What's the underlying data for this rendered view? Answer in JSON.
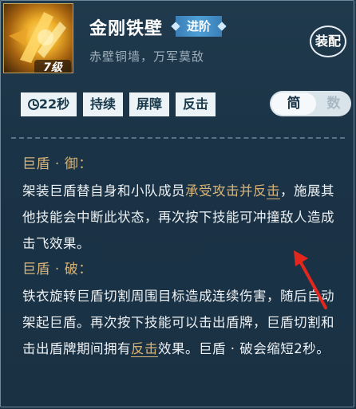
{
  "skill": {
    "name": "金刚铁壁",
    "advance_label": "进阶",
    "subtitle": "赤壁铜墙，万军莫敌",
    "level": "7级",
    "equip_label": "装配"
  },
  "tags": {
    "cooldown": "22秒",
    "items": [
      "持续",
      "屏障",
      "反击"
    ]
  },
  "toggle": {
    "simple": "简",
    "number": "数"
  },
  "description": {
    "section1_title": "巨盾 · 御：",
    "s1_p1": "架装巨盾替自身和小队成员",
    "s1_hl": "承受攻击并反",
    "s1_hl2": "击",
    "s1_p2": "，施展其他技能会中断此状态，再次按下技能可冲撞敌人造成击飞效果。",
    "section2_title": "巨盾 · 破：",
    "s2_p1": "铁衣旋转巨盾切割周围目标造成连续伤害，随后自动架起巨盾。再次按下技能可以击出盾牌，巨盾切割和击出盾牌期间拥有",
    "s2_hl": "反击",
    "s2_p2": "效果。巨盾 · 破会缩短2秒。"
  },
  "colors": {
    "highlight": "#d9b476",
    "advance_tag": "#4e9fd6",
    "annotation_arrow": "#e3271c"
  },
  "icons": {
    "skill_icon": "golden-shield-skill-icon",
    "timer_icon": "clock-icon",
    "annotation": "red-arrow-annotation"
  }
}
